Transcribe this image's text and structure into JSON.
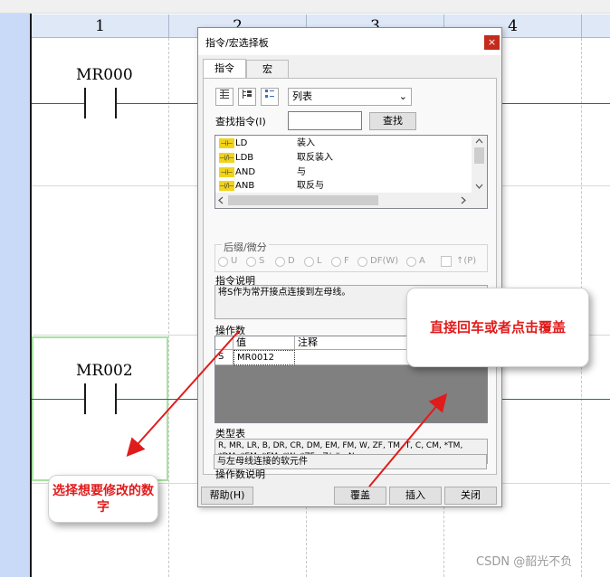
{
  "ladder": {
    "column_headers": [
      "1",
      "2",
      "3",
      "4"
    ],
    "contacts": [
      {
        "label": "MR000"
      },
      {
        "label": "MR002"
      }
    ]
  },
  "dialog": {
    "title": "指令/宏选择板",
    "close_glyph": "×",
    "tabs": [
      "指令",
      "宏"
    ],
    "view_mode": "列表",
    "search_label": "查找指令(I)",
    "search_value": "",
    "search_button": "查找",
    "instructions": [
      {
        "icon": "⊣⊢",
        "name": "LD",
        "desc": "装入"
      },
      {
        "icon": "⊣/⊢",
        "name": "LDB",
        "desc": "取反装入"
      },
      {
        "icon": "⊣⊢",
        "name": "AND",
        "desc": "与"
      },
      {
        "icon": "⊣/⊢",
        "name": "ANB",
        "desc": "取反与"
      }
    ],
    "suffix_group_label": "后缀/微分",
    "suffix_options": [
      "U",
      "S",
      "D",
      "L",
      "F",
      "DF(W)",
      "A"
    ],
    "suffix_extra": "↑(P)",
    "description_label": "指令说明",
    "description_text": "将S作为常开接点连接到左母线。",
    "operand_label": "操作数",
    "operand_columns": [
      "值",
      "注释"
    ],
    "operand_rows": [
      {
        "name": "S",
        "value": "MR0012",
        "comment": ""
      }
    ],
    "type_table_label": "类型表",
    "type_table_text": "R, MR, LR, B, DR, CR, DM, EM, FM, W, ZF, TM, T, C, CM, *TM, *DM, *EM, *FM, *W, *ZF, :Z/:#, .N,",
    "operand_desc_label": "操作数说明",
    "operand_desc_text": "与左母线连接的软元件",
    "buttons": {
      "help": "帮助(H)",
      "overwrite": "覆盖",
      "insert": "插入",
      "close": "关闭"
    }
  },
  "callouts": {
    "right": "直接回车或者点击覆盖",
    "left": "选择想要修改的数字"
  },
  "watermark": "CSDN @韶光不负",
  "colors": {
    "callout_text": "#e11b1b",
    "arrow": "#e11b1b",
    "rail": "#c9daf8",
    "wire": "#1f7a3a",
    "close_button": "#c42b1c"
  }
}
